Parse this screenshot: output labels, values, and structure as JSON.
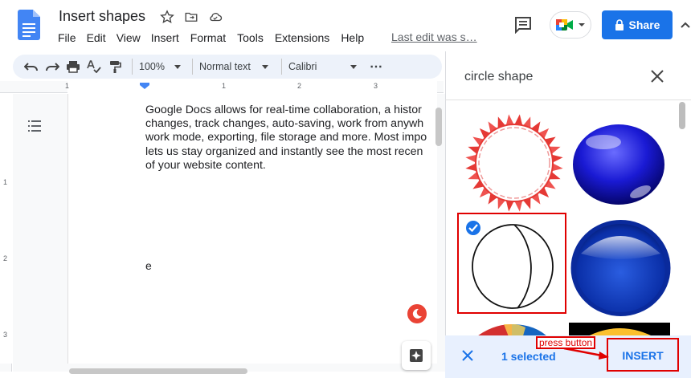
{
  "app": {
    "doc_title": "Insert shapes",
    "last_edit": "Last edit was s…",
    "share_label": "Share"
  },
  "menu": [
    "File",
    "Edit",
    "View",
    "Insert",
    "Format",
    "Tools",
    "Extensions",
    "Help"
  ],
  "toolbar": {
    "zoom": "100%",
    "style": "Normal text",
    "font": "Calibri",
    "more": "⋯"
  },
  "ruler": {
    "h_marks": [
      "1",
      "1",
      "2",
      "3"
    ],
    "v_marks": [
      "1",
      "2",
      "3"
    ]
  },
  "document": {
    "lines": [
      "Google Docs allows for real-time collaboration, a histor",
      "changes, track changes, auto-saving, work from anywh",
      "work mode, exporting, file storage and more. Most impo",
      "lets us stay organized and instantly see the most recen",
      "of your website content."
    ],
    "stray_letter": "e"
  },
  "panel": {
    "search_query": "circle shape",
    "selected_count": "1 selected",
    "insert_label": "INSERT",
    "annotation": "press button"
  },
  "colors": {
    "accent": "#1a73e8",
    "annotation_red": "#e00000",
    "panel_footer": "#e8f0fe"
  }
}
